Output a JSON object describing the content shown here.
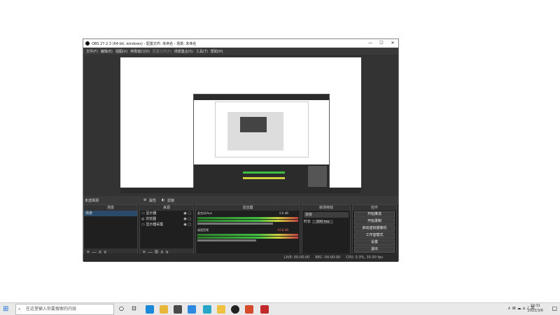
{
  "window": {
    "title": "OBS 27.2.3 (64-bit, windows) - 配置文件: 未命名 - 场景: 未命名",
    "minimize": "—",
    "maximize": "☐",
    "close": "✕"
  },
  "menu": [
    "文件(F)",
    "编辑(E)",
    "视图(V)",
    "停靠窗口(D)",
    "配置文件(P)",
    "场景集合(S)",
    "工具(T)",
    "帮助(H)"
  ],
  "scenebar": {
    "label": "未选择源",
    "properties": "属性",
    "filters": "滤镜"
  },
  "docks": {
    "scenes": {
      "header": "场景",
      "items": [
        "场景"
      ],
      "footer": "+  —  ∧  ∨"
    },
    "sources": {
      "header": "来源",
      "items": [
        "显示器",
        "浏览器",
        "显示器采集"
      ],
      "footer": "+  —  ⚙  ∧  ∨"
    },
    "mixer": {
      "header": "混音器",
      "tracks": [
        {
          "name": "麦克风/Aux",
          "level": "0.0 dB",
          "fill": 0.73
        },
        {
          "name": "桌面音频",
          "level": "-10.8 dB",
          "fill": 0.57
        }
      ]
    },
    "transitions": {
      "header": "转场特效",
      "type": "渐变",
      "duration_label": "时长",
      "duration": "300 ms"
    },
    "controls": {
      "header": "控件",
      "buttons": [
        "开始推流",
        "开始录制",
        "启动虚拟摄像机",
        "工作室模式",
        "设置",
        "退出"
      ]
    }
  },
  "status": {
    "live": "LIVE: 00:00:00",
    "rec": "REC: 00:00:00",
    "cpu": "CPU: 0.3%, 30.00 fps"
  },
  "taskbar": {
    "search_placeholder": "在这里输入你要搜索的内容",
    "tray": "∧  ⊞  ☁  ⌂  ♪  英",
    "time": "10:31",
    "date": "2022/3/6"
  },
  "colors": {
    "obs_bg": "#2b2b2b",
    "meter_green": "#3fbf3f",
    "meter_yellow": "#cfcf3f",
    "meter_red": "#bf3f3f"
  }
}
